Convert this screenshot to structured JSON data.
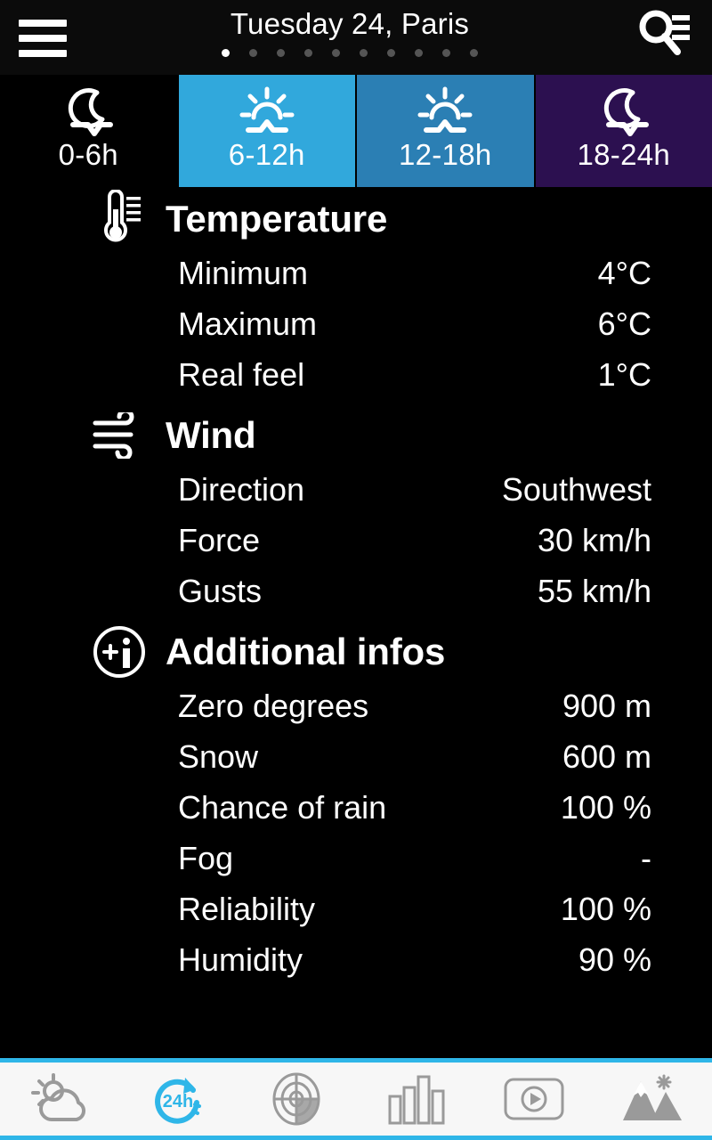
{
  "header": {
    "menu_icon": "hamburger-menu-icon",
    "title": "Tuesday 24, Paris",
    "search_icon": "search-list-icon",
    "pager": {
      "total": 10,
      "active_index": 0
    }
  },
  "tabs": [
    {
      "label": "0-6h",
      "icon": "moon-night-icon",
      "bg": "#000000",
      "active": false
    },
    {
      "label": "6-12h",
      "icon": "sun-day-icon",
      "bg": "#31a8dc",
      "active": true
    },
    {
      "label": "12-18h",
      "icon": "sun-day-icon",
      "bg": "#2b7fb4",
      "active": false
    },
    {
      "label": "18-24h",
      "icon": "moon-night-icon",
      "bg": "#2c1050",
      "active": false
    }
  ],
  "sections": [
    {
      "title": "Temperature",
      "icon": "thermometer-icon",
      "rows": [
        {
          "label": "Minimum",
          "value": "4°C"
        },
        {
          "label": "Maximum",
          "value": "6°C"
        },
        {
          "label": "Real feel",
          "value": "1°C"
        }
      ]
    },
    {
      "title": "Wind",
      "icon": "wind-icon",
      "rows": [
        {
          "label": "Direction",
          "value": "Southwest"
        },
        {
          "label": "Force",
          "value": "30 km/h"
        },
        {
          "label": "Gusts",
          "value": "55 km/h"
        }
      ]
    },
    {
      "title": "Additional infos",
      "icon": "info-plus-icon",
      "rows": [
        {
          "label": "Zero degrees",
          "value": "900 m"
        },
        {
          "label": "Snow",
          "value": "600 m"
        },
        {
          "label": "Chance of rain",
          "value": "100 %"
        },
        {
          "label": "Fog",
          "value": "-"
        },
        {
          "label": "Reliability",
          "value": "100 %"
        },
        {
          "label": "Humidity",
          "value": "90 %"
        }
      ]
    }
  ],
  "bottombar": {
    "items": [
      {
        "icon": "sun-cloud-icon",
        "active": false
      },
      {
        "icon": "24h-forecast-icon",
        "active": true,
        "label": "24h"
      },
      {
        "icon": "radar-icon",
        "active": false
      },
      {
        "icon": "bar-chart-icon",
        "active": false
      },
      {
        "icon": "video-play-icon",
        "active": false
      },
      {
        "icon": "mountain-snow-icon",
        "active": false
      }
    ],
    "active_color": "#2fb6e8",
    "inactive_color": "#9a9a9a"
  },
  "theme": {
    "bg_top": "#2274ab",
    "bg_bottom": "#030a22",
    "accent": "#2fb6e8",
    "header_bg": "#0b0b0b",
    "text": "#ffffff"
  }
}
